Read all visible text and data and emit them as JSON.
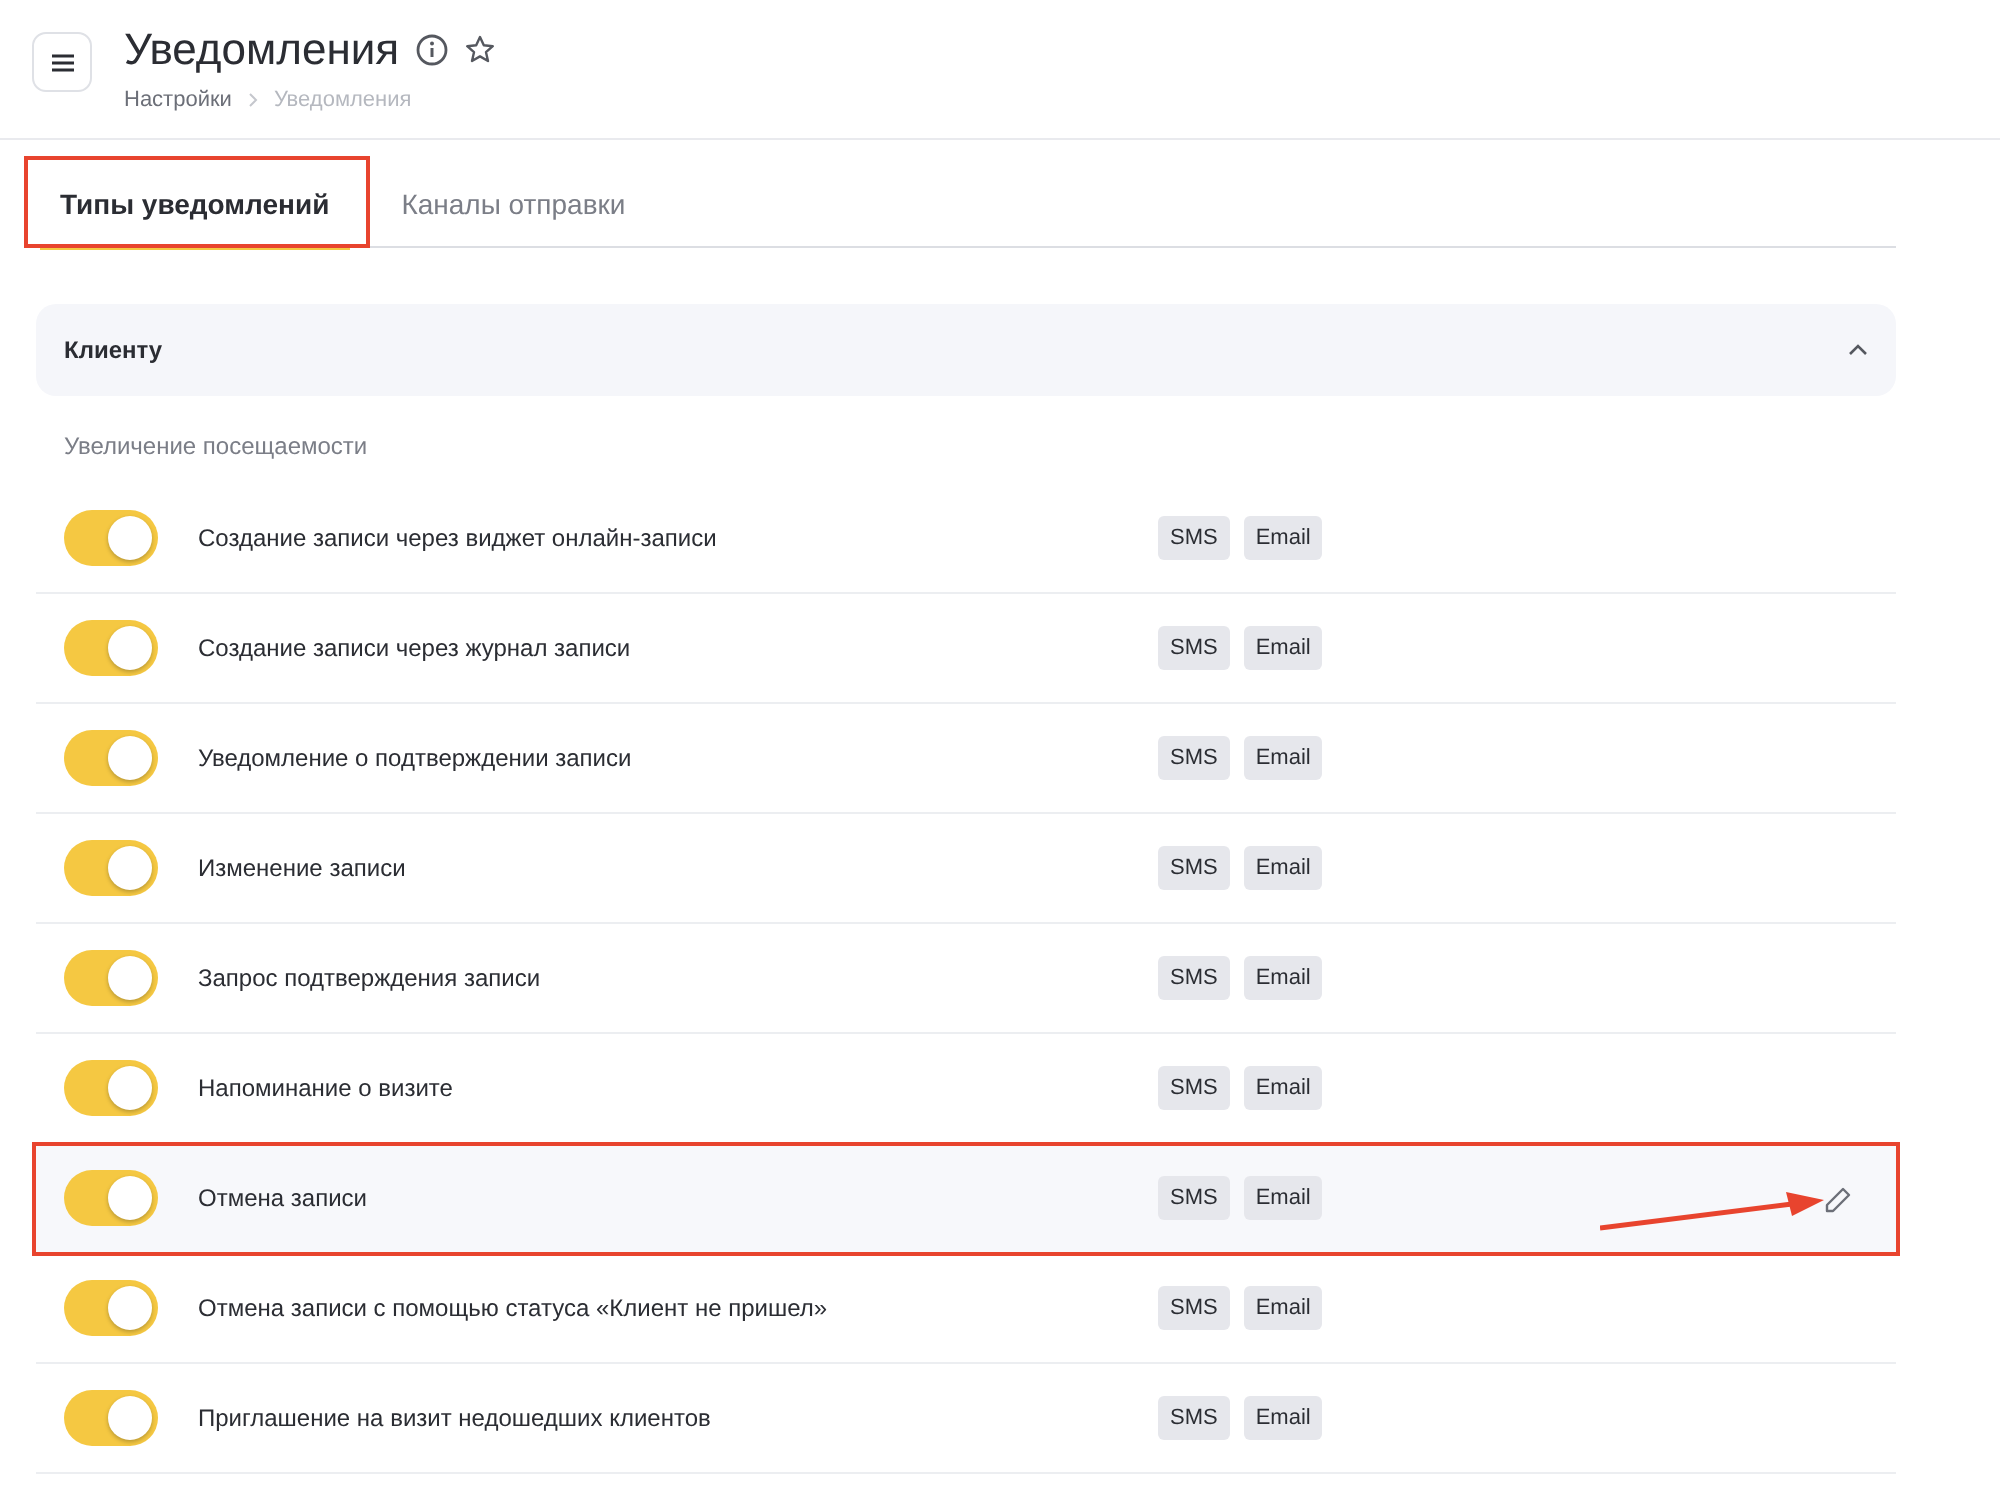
{
  "header": {
    "title": "Уведомления",
    "breadcrumbs": [
      "Настройки",
      "Уведомления"
    ]
  },
  "tabs": [
    {
      "label": "Типы уведомлений",
      "selected": true,
      "annotated": true
    },
    {
      "label": "Каналы отправки",
      "selected": false,
      "annotated": false
    }
  ],
  "section": {
    "title": "Клиенту",
    "expanded": true,
    "group_title": "Увеличение посещаемости",
    "rows": [
      {
        "label": "Создание записи через виджет онлайн-записи",
        "on": true,
        "channels": [
          "SMS",
          "Email"
        ],
        "hovered": false,
        "annotated": false
      },
      {
        "label": "Создание записи через журнал записи",
        "on": true,
        "channels": [
          "SMS",
          "Email"
        ],
        "hovered": false,
        "annotated": false
      },
      {
        "label": "Уведомление о подтверждении записи",
        "on": true,
        "channels": [
          "SMS",
          "Email"
        ],
        "hovered": false,
        "annotated": false
      },
      {
        "label": "Изменение записи",
        "on": true,
        "channels": [
          "SMS",
          "Email"
        ],
        "hovered": false,
        "annotated": false
      },
      {
        "label": "Запрос подтверждения записи",
        "on": true,
        "channels": [
          "SMS",
          "Email"
        ],
        "hovered": false,
        "annotated": false
      },
      {
        "label": "Напоминание о визите",
        "on": true,
        "channels": [
          "SMS",
          "Email"
        ],
        "hovered": false,
        "annotated": false
      },
      {
        "label": "Отмена записи",
        "on": true,
        "channels": [
          "SMS",
          "Email"
        ],
        "hovered": true,
        "annotated": true
      },
      {
        "label": "Отмена записи с помощью статуса «Клиент не пришел»",
        "on": true,
        "channels": [
          "SMS",
          "Email"
        ],
        "hovered": false,
        "annotated": false
      },
      {
        "label": "Приглашение на визит недошедших клиентов",
        "on": true,
        "channels": [
          "SMS",
          "Email"
        ],
        "hovered": false,
        "annotated": false
      }
    ]
  }
}
